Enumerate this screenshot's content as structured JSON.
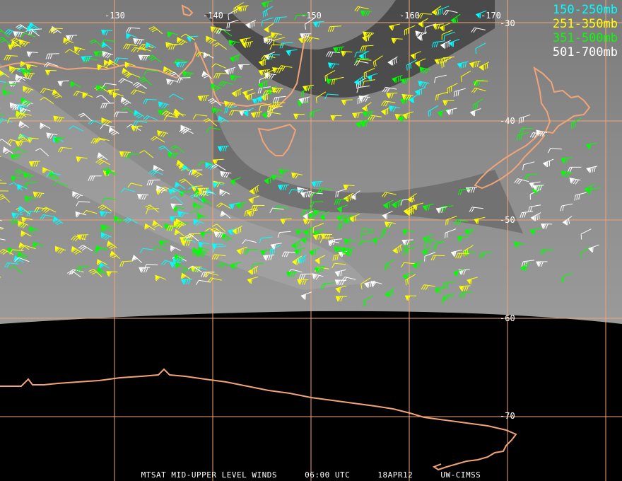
{
  "map": {
    "longitude_labels": [
      "-130",
      "-140",
      "-150",
      "-160",
      "-170"
    ],
    "latitude_labels": [
      "-30",
      "-40",
      "-50",
      "-60",
      "-70"
    ],
    "colors": {
      "grid": "#f2a477",
      "coast": "#f2a477",
      "layer_150_250": "#00ffff",
      "layer_251_350": "#ffff00",
      "layer_351_500": "#00ff00",
      "layer_501_700": "#ffffff"
    }
  },
  "legend": [
    {
      "label": "150-250mb",
      "color": "#00ffff"
    },
    {
      "label": "251-350mb",
      "color": "#ffff00"
    },
    {
      "label": "351-500mb",
      "color": "#00ff00"
    },
    {
      "label": "501-700mb",
      "color": "#ffffff"
    }
  ],
  "footer": {
    "product": "MTSAT MID-UPPER LEVEL WINDS",
    "time": "06:00 UTC",
    "date": "18APR12",
    "source": "UW-CIMSS"
  }
}
